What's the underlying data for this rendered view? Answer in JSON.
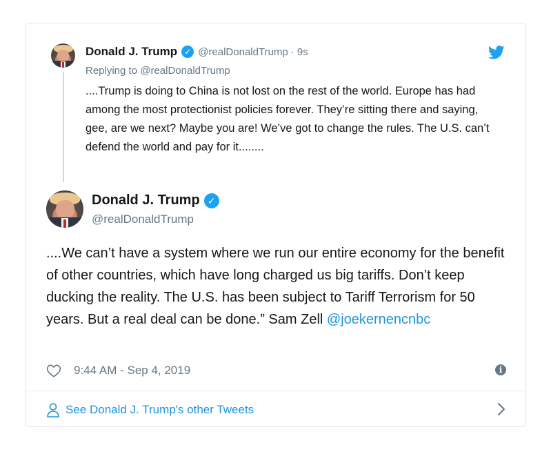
{
  "quoted_tweet": {
    "author_name": "Donald J. Trump",
    "author_handle": "@realDonaldTrump",
    "time": "· 9s",
    "replying_prefix": "Replying to",
    "replying_to": "@realDonaldTrump",
    "text": "....Trump is doing to China is not lost on the rest of the world. Europe has had among the most protectionist policies forever. They’re sitting there and saying, gee, are we next? Maybe you are! We’ve got to change the rules. The U.S. can’t defend the world and pay for it........"
  },
  "main_tweet": {
    "author_name": "Donald J. Trump",
    "author_handle": "@realDonaldTrump",
    "text": "....We can’t have a system where we run our entire economy for the benefit of other countries, which have long charged us big tariffs. Don’t keep ducking the reality. The U.S. has been subject to Tariff Terrorism for 50 years. But a real deal can be done.” Sam Zell",
    "mention": "@joekernencnbc",
    "timestamp": "9:44 AM - Sep 4, 2019"
  },
  "footer": {
    "link_text": "See Donald J. Trump's other Tweets"
  },
  "icons": {
    "verified": "verified-badge-icon",
    "bird": "twitter-bird-icon",
    "heart": "heart-icon",
    "info": "info-icon",
    "person": "person-icon",
    "chevron": "chevron-right-icon"
  },
  "colors": {
    "twitter_blue": "#1da1f2",
    "link_blue": "#1b95e0",
    "muted_gray": "#657786",
    "border": "#e1e8ed"
  }
}
